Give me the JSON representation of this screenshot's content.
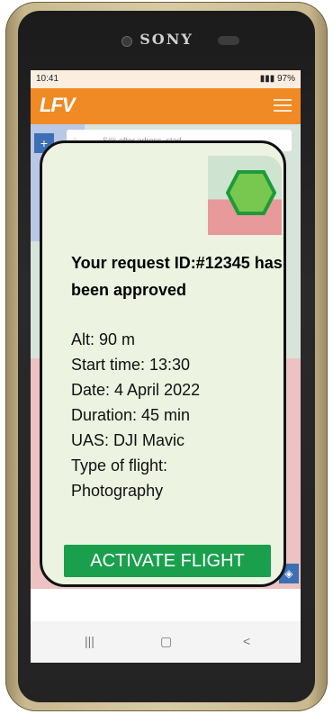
{
  "device": {
    "brand": "SONY"
  },
  "status_bar": {
    "time": "10:41",
    "battery": "97%"
  },
  "app": {
    "logo": "LFV"
  },
  "map": {
    "search_placeholder": "Sök efter adress, stad..."
  },
  "request": {
    "title": "Your request ID:#12345 has been approved",
    "altitude": "Alt: 90 m",
    "start_time": "Start time: 13:30",
    "date": "Date: 4 April 2022",
    "duration": "Duration: 45 min",
    "uas": "UAS: DJI Mavic",
    "flight_type_label": "Type of flight:",
    "flight_type": "Photography",
    "activate_label": "ACTIVATE FLIGHT"
  },
  "nav": {
    "recent_glyph": "|||",
    "home_glyph": "▢",
    "back_glyph": "<"
  },
  "colors": {
    "appbar": "#f08a24",
    "activate_button": "#1aa04d",
    "hex_fill": "#78c850",
    "hex_stroke": "#1f9a3a"
  }
}
